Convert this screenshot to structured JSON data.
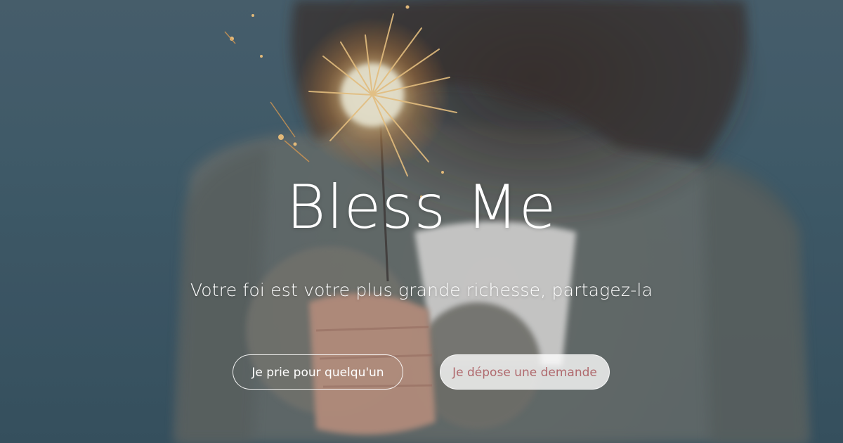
{
  "hero": {
    "title": "Bless Me",
    "subtitle": "Votre foi est votre plus grande richesse, partagez-la",
    "buttons": {
      "pray_label": "Je prie pour quelqu'un",
      "request_label": "Je dépose une demande"
    },
    "colors": {
      "background_blue": "#456170",
      "sweater_gray": "#7a7c78",
      "spark_gold": "#f7c27a",
      "text_white": "#ffffff",
      "request_button_text": "#b06a6e"
    }
  }
}
